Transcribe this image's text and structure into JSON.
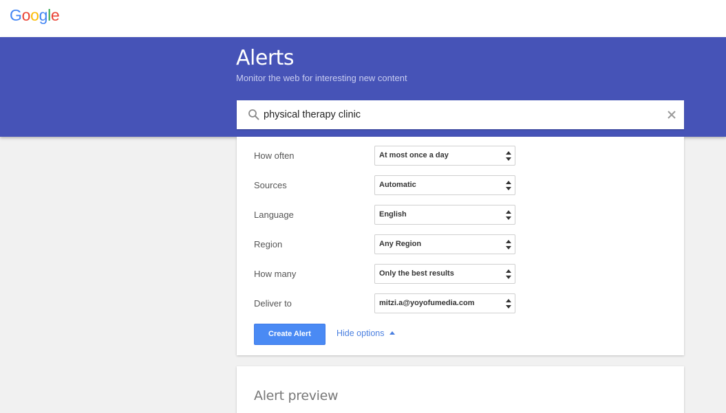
{
  "logo": {
    "letters": [
      "G",
      "o",
      "o",
      "g",
      "l",
      "e"
    ],
    "colors": [
      "#4285f4",
      "#ea4335",
      "#fbbc05",
      "#4285f4",
      "#34a853",
      "#ea4335"
    ]
  },
  "header": {
    "title": "Alerts",
    "subtitle": "Monitor the web for interesting new content"
  },
  "search": {
    "value": "physical therapy clinic",
    "icon": "search-icon",
    "clear_icon": "close-icon"
  },
  "options": [
    {
      "label": "How often",
      "value": "At most once a day"
    },
    {
      "label": "Sources",
      "value": "Automatic"
    },
    {
      "label": "Language",
      "value": "English"
    },
    {
      "label": "Region",
      "value": "Any Region"
    },
    {
      "label": "How many",
      "value": "Only the best results"
    },
    {
      "label": "Deliver to",
      "value": "mitzi.a@yoyofumedia.com"
    }
  ],
  "actions": {
    "create_label": "Create Alert",
    "hide_label": "Hide options"
  },
  "preview": {
    "title": "Alert preview"
  },
  "colors": {
    "header_bg": "#4653b7",
    "button_bg": "#4a8af4",
    "link": "#4a7fe0"
  }
}
